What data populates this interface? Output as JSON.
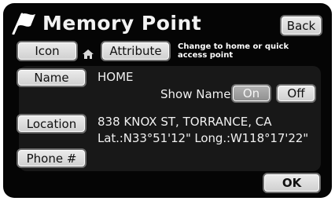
{
  "header": {
    "title": "Memory Point",
    "back_label": "Back"
  },
  "attributes": {
    "icon_label": "Icon",
    "attribute_label": "Attribute",
    "hint": "Change to home or quick access point"
  },
  "name": {
    "label": "Name",
    "value": "HOME"
  },
  "show_name": {
    "label": "Show Name",
    "on_label": "On",
    "off_label": "Off",
    "selected": "On"
  },
  "location": {
    "label": "Location",
    "address": "838 KNOX ST, TORRANCE, CA",
    "coords": "Lat.:N33°51'12\" Long.:W118°17'22\""
  },
  "phone": {
    "label": "Phone #"
  },
  "footer": {
    "ok_label": "OK"
  },
  "colors": {
    "screen_bg": "#050505",
    "button_face": "#dedede",
    "selected_button": "#a0a0a0"
  },
  "icons": [
    "flag-icon",
    "house-icon"
  ]
}
